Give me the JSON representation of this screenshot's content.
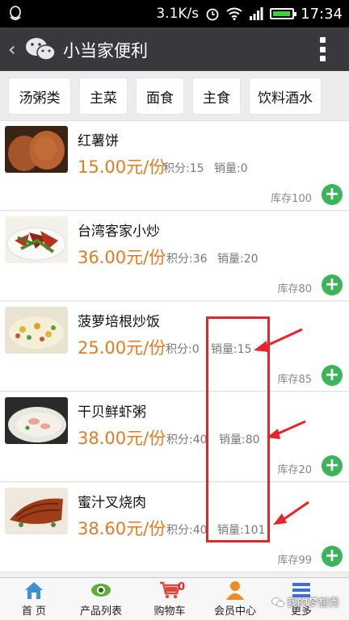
{
  "status": {
    "speed": "3.1K/s",
    "time": "17:34"
  },
  "header": {
    "back": "‹",
    "title": "小当家便利"
  },
  "tabs": [
    "汤粥类",
    "主菜",
    "面食",
    "主食",
    "饮料酒水"
  ],
  "products": [
    {
      "name": "红薯饼",
      "price": "15.00元/份",
      "points": "积分:15",
      "sales": "销量:0",
      "stock": "库存100"
    },
    {
      "name": "台湾客家小炒",
      "price": "36.00元/份",
      "points": "积分:36",
      "sales": "销量:20",
      "stock": "库存80"
    },
    {
      "name": "菠萝培根炒饭",
      "price": "25.00元/份",
      "points": "积分:0",
      "sales": "销量:15",
      "stock": "库存85"
    },
    {
      "name": "干贝鲜虾粥",
      "price": "38.00元/份",
      "points": "积分:40",
      "sales": "销量:80",
      "stock": "库存20"
    },
    {
      "name": "蜜汁叉烧肉",
      "price": "38.60元/份",
      "points": "积分:40",
      "sales": "销量:101",
      "stock": "库存99"
    }
  ],
  "nav": {
    "home": "首 页",
    "products": "产品列表",
    "cart": "购物车",
    "cart_count": "0",
    "member": "会员中心",
    "more": "更多"
  },
  "watermark": "我的梦想秀"
}
